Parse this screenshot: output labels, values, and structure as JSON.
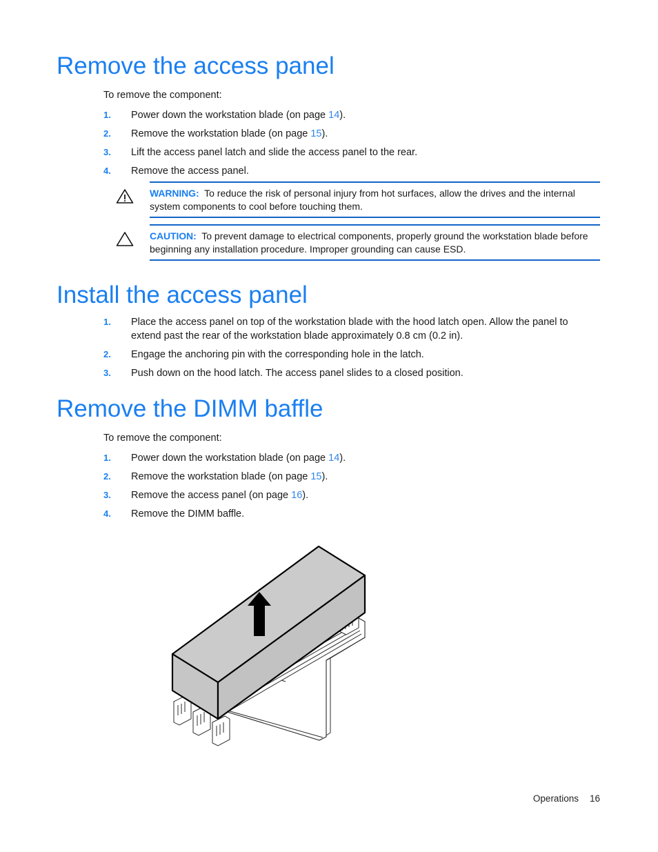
{
  "document": {
    "footer": {
      "section": "Operations",
      "page_number": "16"
    }
  },
  "sections": [
    {
      "heading": "Remove the access panel",
      "intro": "To remove the component:",
      "steps": [
        {
          "num": "1.",
          "text_before": "Power down the workstation blade (on page ",
          "link": "14",
          "text_after": ")."
        },
        {
          "num": "2.",
          "text_before": "Remove the workstation blade (on page ",
          "link": "15",
          "text_after": ")."
        },
        {
          "num": "3.",
          "text_before": "Lift the access panel latch and slide the access panel to the rear.",
          "link": "",
          "text_after": ""
        },
        {
          "num": "4.",
          "text_before": "Remove the access panel.",
          "link": "",
          "text_after": ""
        }
      ]
    },
    {
      "heading": "Install the access panel",
      "intro": "",
      "steps": [
        {
          "num": "1.",
          "text_before": "Place the access panel on top of the workstation blade with the hood latch open. Allow the panel to extend past the rear of the workstation blade approximately 0.8 cm (0.2 in).",
          "link": "",
          "text_after": ""
        },
        {
          "num": "2.",
          "text_before": "Engage the anchoring pin with the corresponding hole in the latch.",
          "link": "",
          "text_after": ""
        },
        {
          "num": "3.",
          "text_before": "Push down on the hood latch. The access panel slides to a closed position.",
          "link": "",
          "text_after": ""
        }
      ]
    },
    {
      "heading": "Remove the DIMM baffle",
      "intro": "To remove the component:",
      "steps": [
        {
          "num": "1.",
          "text_before": "Power down the workstation blade (on page ",
          "link": "14",
          "text_after": ")."
        },
        {
          "num": "2.",
          "text_before": "Remove the workstation blade (on page ",
          "link": "15",
          "text_after": ")."
        },
        {
          "num": "3.",
          "text_before": "Remove the access panel (on page ",
          "link": "16",
          "text_after": ")."
        },
        {
          "num": "4.",
          "text_before": "Remove the DIMM baffle.",
          "link": "",
          "text_after": ""
        }
      ]
    }
  ],
  "notices": [
    {
      "type": "warning",
      "icon": "warning-triangle-exclamation-icon",
      "label": "WARNING:",
      "text": "To reduce the risk of personal injury from hot surfaces, allow the drives and the internal system components to cool before touching them."
    },
    {
      "type": "caution",
      "icon": "caution-triangle-icon",
      "label": "CAUTION:",
      "text": "To prevent damage to electrical components, properly ground the workstation blade before beginning any installation procedure. Improper grounding can cause ESD."
    }
  ],
  "figure": {
    "caption": "",
    "description": "DIMM baffle removal illustration",
    "arrow": "up-arrow"
  },
  "colors": {
    "heading_blue": "#1a7ff0",
    "rule_blue": "#1264c8",
    "link_blue": "#2f86e8",
    "body_black": "#1a1a1a",
    "figure_gray": "#cccccc"
  }
}
